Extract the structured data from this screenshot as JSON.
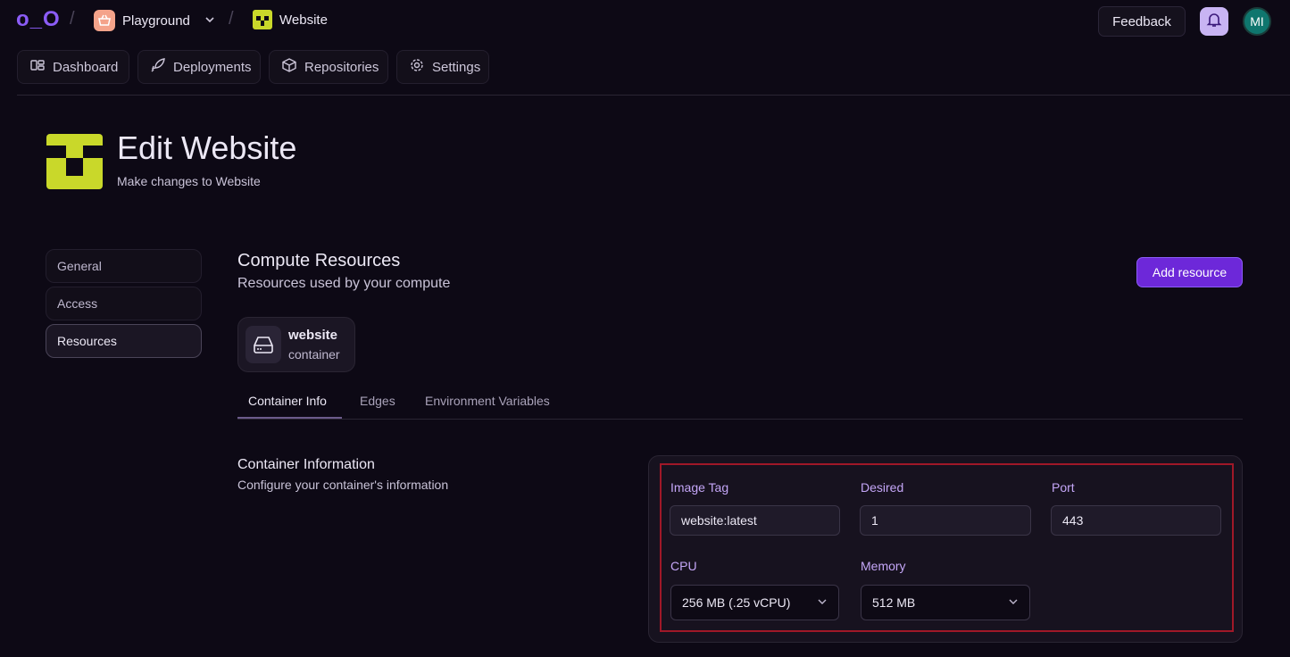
{
  "header": {
    "logo": "o_O",
    "team": "Playground",
    "project": "Website",
    "feedback_label": "Feedback",
    "avatar_initials": "MI"
  },
  "nav": [
    {
      "label": "Dashboard",
      "icon": "dashboard-icon"
    },
    {
      "label": "Deployments",
      "icon": "rocket-icon"
    },
    {
      "label": "Repositories",
      "icon": "box-icon"
    },
    {
      "label": "Settings",
      "icon": "gear-icon"
    }
  ],
  "page": {
    "title": "Edit Website",
    "subtitle": "Make changes to Website"
  },
  "sidebar": {
    "items": [
      {
        "label": "General"
      },
      {
        "label": "Access"
      },
      {
        "label": "Resources",
        "active": true
      }
    ]
  },
  "section": {
    "title": "Compute Resources",
    "subtitle": "Resources used by your compute",
    "add_button": "Add resource"
  },
  "resource": {
    "name": "website",
    "type": "container"
  },
  "tabs": [
    {
      "label": "Container Info",
      "active": true
    },
    {
      "label": "Edges"
    },
    {
      "label": "Environment Variables"
    }
  ],
  "container_info": {
    "title": "Container Information",
    "subtitle": "Configure your container's information",
    "image_tag_label": "Image Tag",
    "image_tag_value": "website:latest",
    "desired_label": "Desired",
    "desired_value": "1",
    "port_label": "Port",
    "port_value": "443",
    "cpu_label": "CPU",
    "cpu_value": "256 MB (.25 vCPU)",
    "memory_label": "Memory",
    "memory_value": "512 MB"
  },
  "colors": {
    "accent": "#6d28d9",
    "background": "#0d0915",
    "highlight": "#a01828"
  }
}
